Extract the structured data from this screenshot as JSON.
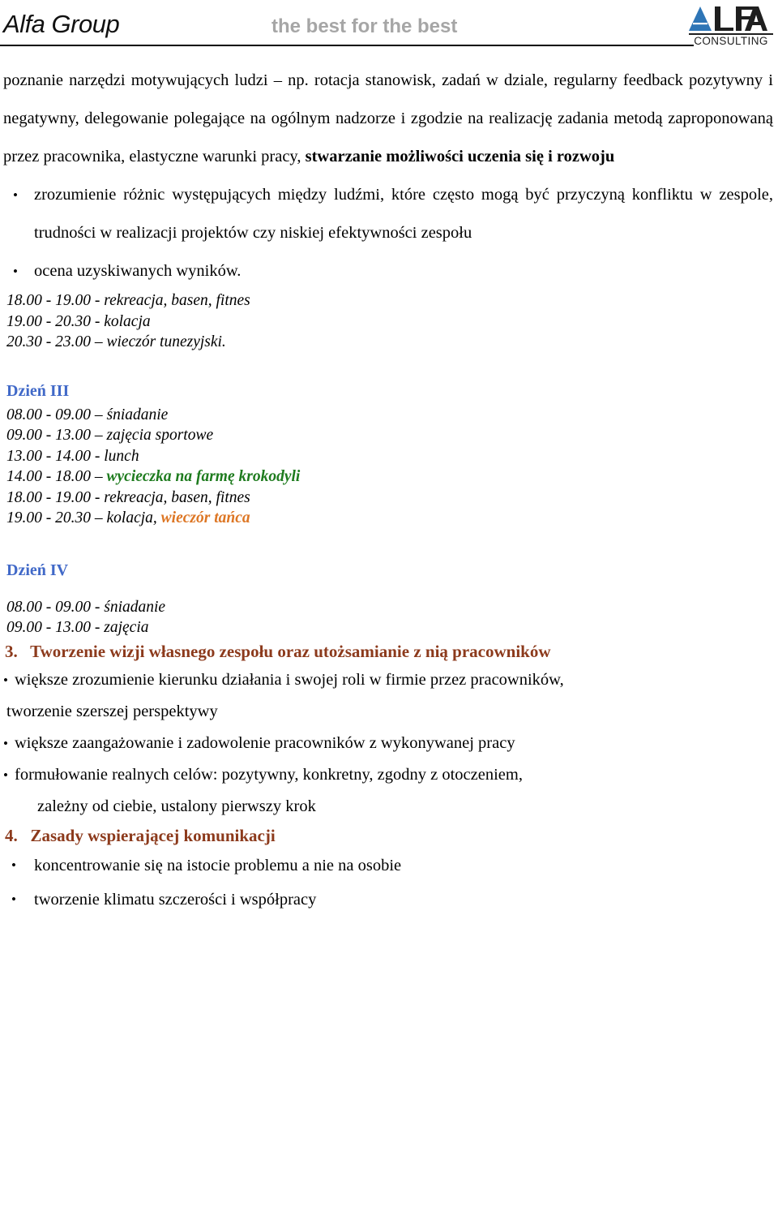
{
  "header": {
    "brand": "Alfa Group",
    "tagline": "the best for the best",
    "logo": {
      "name": "ALFA",
      "subtitle": "CONSULTING",
      "triangle_color": "#2E75B6",
      "text_color": "#1F1F1F"
    }
  },
  "colors": {
    "text": "#000000",
    "day_heading_blue": "#4169C8",
    "excursion_green": "#1E7B1E",
    "evening_orange": "#DD7624",
    "section_heading_brown": "#8C3A1C",
    "tagline_gray": "#A6A6A6"
  },
  "content": {
    "paragraph_1": {
      "plain_before": "poznanie narzędzi motywujących ludzi – np. rotacja stanowisk, zadań w dziale, regularny feedback   pozytywny i negatywny, delegowanie polegające na ogólnym nadzorze i zgodzie na realizację zadania metodą zaproponowaną przez pracownika, elastyczne warunki pracy,  ",
      "bold_part": "stwarzanie możliwości uczenia się i rozwoju"
    },
    "bullets_top": [
      "zrozumienie   różnic występujących między ludźmi, które często mogą być przyczyną konfliktu w zespole,   trudności w realizacji projektów czy niskiej efektywności zespołu",
      "ocena uzyskiwanych wyników."
    ],
    "schedule_block_1": [
      "18.00 - 19.00 - rekreacja, basen, fitnes",
      "19.00 - 20.30 - kolacja",
      "20.30 - 23.00 – wieczór tunezyjski."
    ],
    "day_3": {
      "heading": "Dzień III",
      "rows": [
        {
          "time": "08.00 - 09.00 – ",
          "activity": "śniadanie",
          "style": "plain"
        },
        {
          "time": "09.00 - 13.00 – ",
          "activity": "zajęcia sportowe",
          "style": "plain"
        },
        {
          "time": "13.00 - 14.00 - ",
          "activity": "lunch",
          "style": "plain"
        },
        {
          "time": "14.00 - 18.00 – ",
          "activity": "wycieczka na farmę krokodyli",
          "style": "green-bold"
        },
        {
          "time": "18.00 - 19.00 - ",
          "activity": "rekreacja, basen, fitnes",
          "style": "plain"
        },
        {
          "time": "19.00 - 20.30 – ",
          "activity": "kolacja, ",
          "extra": "wieczór tańca",
          "style": "orange-bold"
        }
      ]
    },
    "day_4": {
      "heading": "Dzień IV",
      "rows": [
        {
          "time": "08.00 - 09.00 - ",
          "activity": "śniadanie",
          "style": "plain"
        },
        {
          "time": "09.00 - 13.00 - ",
          "activity": "zajęcia",
          "style": "plain"
        }
      ]
    },
    "section_3": {
      "number": "3.",
      "title": "Tworzenie  wizji własnego zespołu  oraz  utożsamianie z nią pracowników",
      "bullets": [
        {
          "text": "większe zrozumienie  kierunku działania i swojej roli w firmie przez pracowników,",
          "continuation": "tworzenie szerszej perspektywy"
        },
        {
          "text": "większe zaangażowanie  i zadowolenie pracowników z wykonywanej pracy",
          "continuation": ""
        },
        {
          "text": "formułowanie realnych celów: pozytywny, konkretny, zgodny z otoczeniem,",
          "continuation": "zależny od ciebie, ustalony pierwszy krok"
        }
      ]
    },
    "section_4": {
      "number": "4.",
      "title": "Zasady wspierającej komunikacji",
      "bullets": [
        "koncentrowanie się na istocie problemu a nie na osobie",
        "tworzenie klimatu szczerości i współpracy"
      ]
    }
  }
}
